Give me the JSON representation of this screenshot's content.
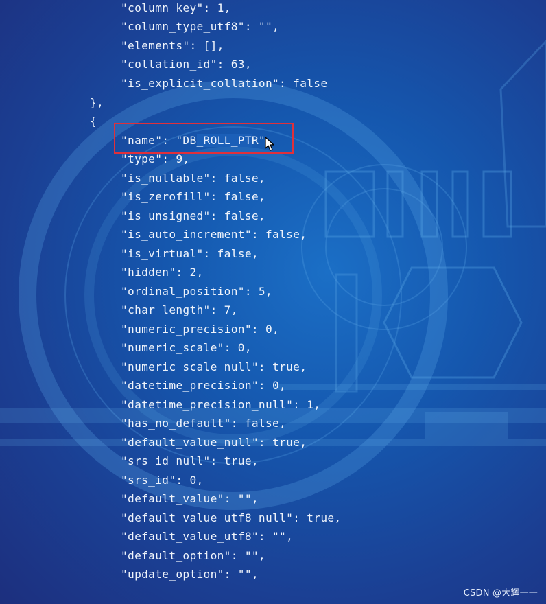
{
  "code_lines": [
    "\"column_key\": 1,",
    "\"column_type_utf8\": \"\",",
    "\"elements\": [],",
    "\"collation_id\": 63,",
    "\"is_explicit_collation\": false",
    "},",
    "{",
    "\"type\": 9,",
    "\"is_nullable\": false,",
    "\"is_zerofill\": false,",
    "\"is_unsigned\": false,",
    "\"is_auto_increment\": false,",
    "\"is_virtual\": false,",
    "\"hidden\": 2,",
    "\"ordinal_position\": 5,",
    "\"char_length\": 7,",
    "\"numeric_precision\": 0,",
    "\"numeric_scale\": 0,",
    "\"numeric_scale_null\": true,",
    "\"datetime_precision\": 0,",
    "\"datetime_precision_null\": 1,",
    "\"has_no_default\": false,",
    "\"default_value_null\": true,",
    "\"srs_id_null\": true,",
    "\"srs_id\": 0,",
    "\"default_value\": \"\",",
    "\"default_value_utf8_null\": true,",
    "\"default_value_utf8\": \"\",",
    "\"default_option\": \"\",",
    "\"update_option\": \"\","
  ],
  "name_line": {
    "prefix": "\"name\": \"DB",
    "selected": "_ROLL_PT",
    "suffix": "R\","
  },
  "watermark": "CSDN @大辉一一",
  "colors": {
    "text": "#eef3fb",
    "selection": "#1b5fb8",
    "highlight_box": "#e0303b"
  }
}
